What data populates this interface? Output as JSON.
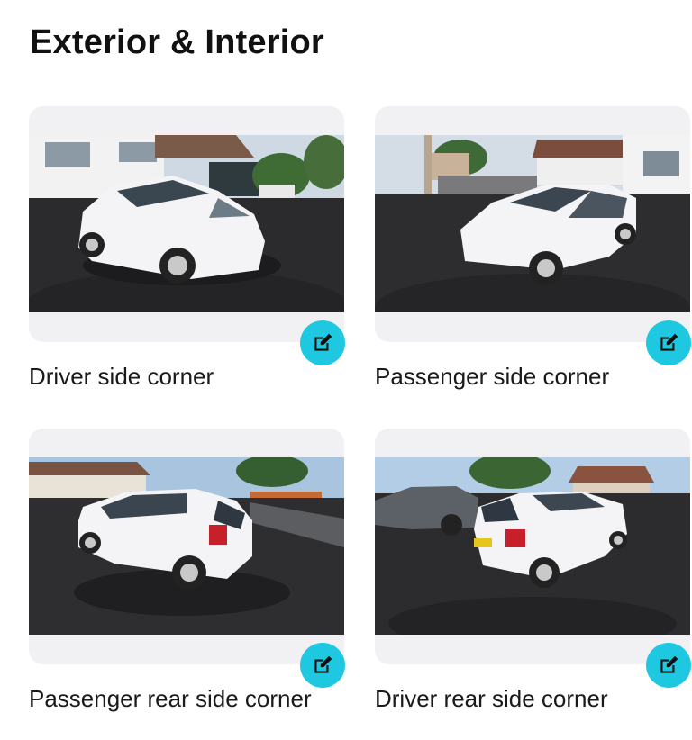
{
  "page": {
    "title": "Exterior & Interior"
  },
  "colors": {
    "accent": "#1ec8e0",
    "card_bg": "#f1f1f3",
    "text": "#1a1a1a"
  },
  "cards": [
    {
      "label": "Driver side corner",
      "photo": "white hatchback, driver side front corner view",
      "action_icon": "edit-icon"
    },
    {
      "label": "Passenger side corner",
      "photo": "white hatchback, passenger side front corner view",
      "action_icon": "edit-icon"
    },
    {
      "label": "Passenger rear side corner",
      "photo": "white hatchback, passenger side rear corner view",
      "action_icon": "edit-icon"
    },
    {
      "label": "Driver rear side corner",
      "photo": "white hatchback, driver side rear corner view",
      "action_icon": "edit-icon"
    }
  ]
}
